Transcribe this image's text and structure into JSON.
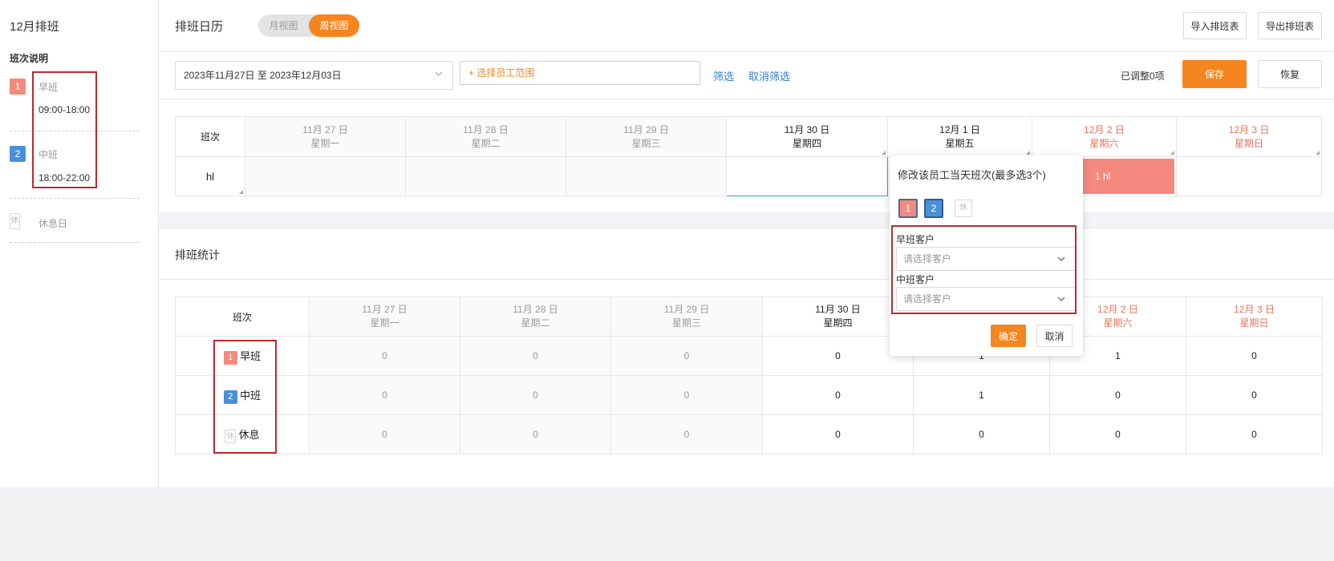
{
  "sidebar": {
    "title": "12月排班",
    "subtitle": "班次说明",
    "shifts": [
      {
        "code": "1",
        "name": "早班",
        "time": "09:00-18:00"
      },
      {
        "code": "2",
        "name": "中班",
        "time": "18:00-22:00"
      },
      {
        "code": "休",
        "name": "休息日"
      }
    ]
  },
  "header": {
    "title": "排班日历",
    "toggle": {
      "month": "月视图",
      "week": "周视图",
      "active": "week"
    },
    "import_label": "导入排班表",
    "export_label": "导出排班表"
  },
  "toolbar": {
    "date_range": "2023年11月27日 至 2023年12月03日",
    "employee_placeholder": "+ 选择员工范围",
    "filter_label": "筛选",
    "cancel_filter_label": "取消筛选",
    "adjusted_count": "已调整0项",
    "save_label": "保存",
    "restore_label": "恢复"
  },
  "calendar": {
    "first_col": "班次",
    "days": [
      {
        "date": "11月 27 日",
        "weekday": "星期一",
        "kind": "past"
      },
      {
        "date": "11月 28 日",
        "weekday": "星期二",
        "kind": "past"
      },
      {
        "date": "11月 29 日",
        "weekday": "星期三",
        "kind": "past"
      },
      {
        "date": "11月 30 日",
        "weekday": "星期四",
        "kind": "current"
      },
      {
        "date": "12月 1 日",
        "weekday": "星期五",
        "kind": "current"
      },
      {
        "date": "12月 2 日",
        "weekday": "星期六",
        "kind": "weekend"
      },
      {
        "date": "12月 3 日",
        "weekday": "星期日",
        "kind": "weekend"
      }
    ],
    "rows": [
      {
        "employee": "hl",
        "cells": [
          "",
          "",
          "",
          "",
          "",
          "1 hl",
          ""
        ]
      }
    ]
  },
  "stats": {
    "title": "排班统计",
    "first_col": "班次",
    "rows": [
      {
        "code": "1",
        "name": "早班",
        "values": [
          "0",
          "0",
          "0",
          "0",
          "1",
          "1",
          "0"
        ]
      },
      {
        "code": "2",
        "name": "中班",
        "values": [
          "0",
          "0",
          "0",
          "0",
          "1",
          "0",
          "0"
        ]
      },
      {
        "code": "休",
        "name": "休息",
        "values": [
          "0",
          "0",
          "0",
          "0",
          "0",
          "0",
          "0"
        ]
      }
    ]
  },
  "popup": {
    "title": "修改该员工当天班次(最多选3个)",
    "options": [
      "1",
      "2",
      "休"
    ],
    "morning_label": "早班客户",
    "mid_label": "中班客户",
    "select_placeholder": "请选择客户",
    "confirm_label": "确定",
    "cancel_label": "取消"
  },
  "colors": {
    "accent": "#f5851f",
    "morning": "#f28a80",
    "mid": "#4a90d9",
    "weekend_text": "#e8735a",
    "link": "#2f7fcf",
    "highlight": "#c1272d"
  }
}
